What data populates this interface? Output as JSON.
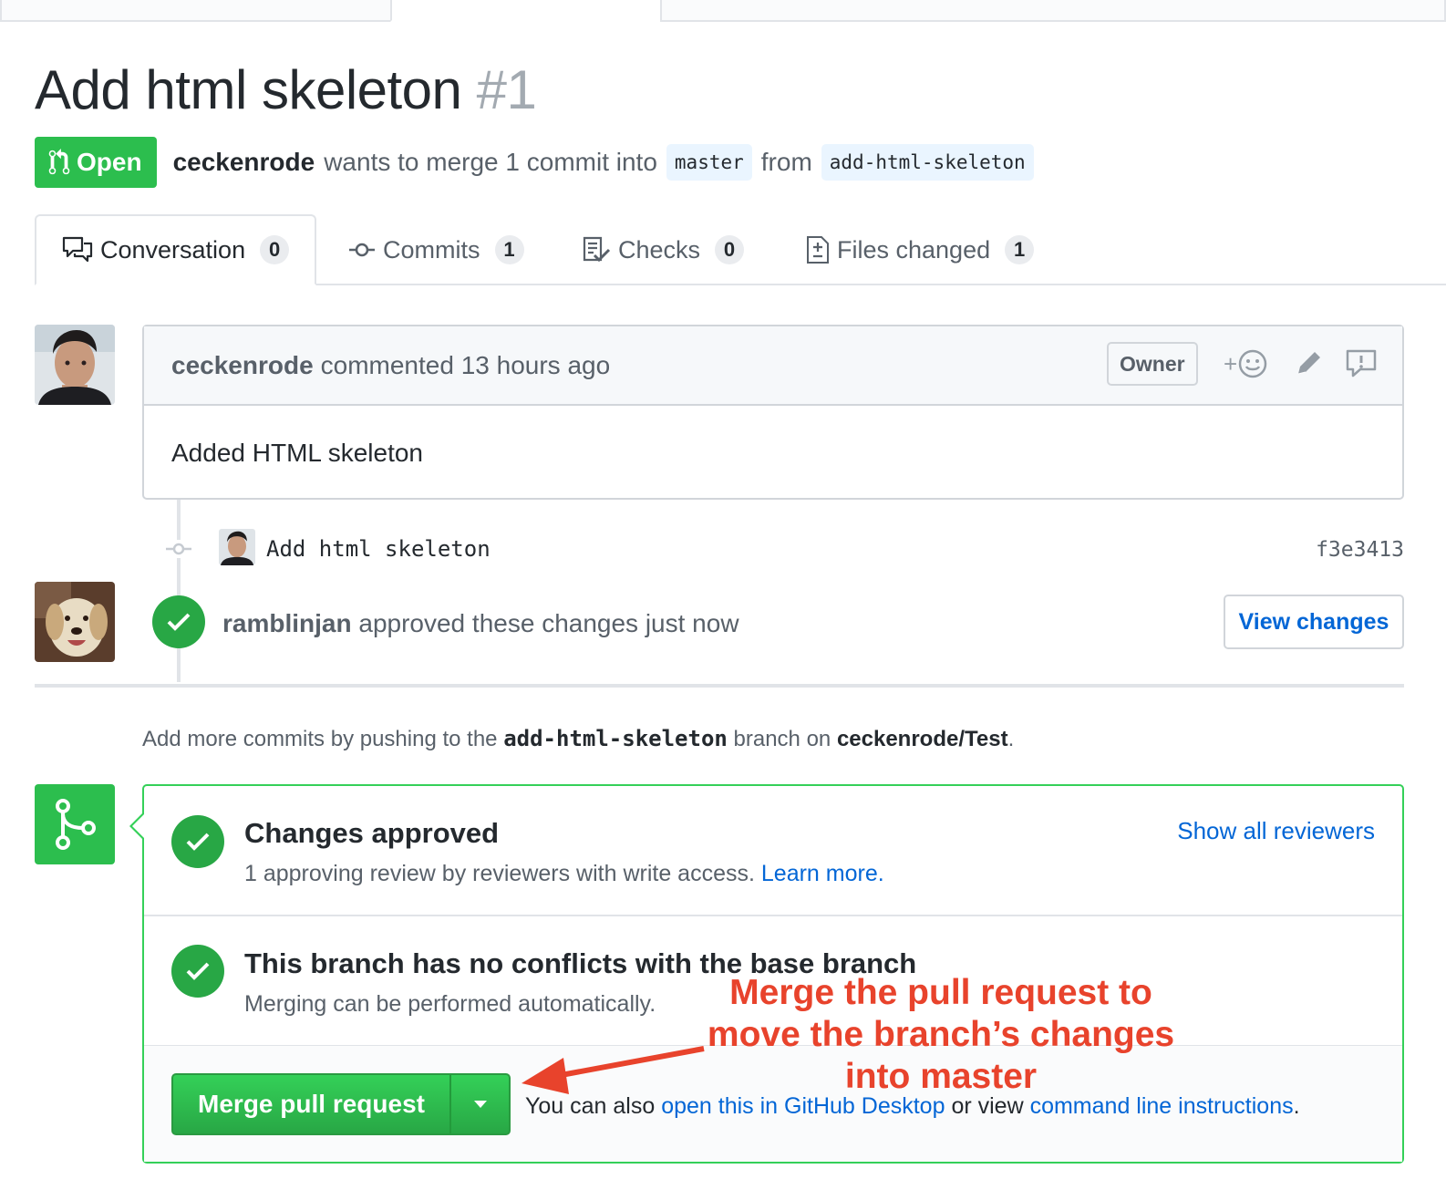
{
  "pr": {
    "title": "Add html skeleton",
    "number": "#1",
    "state": "Open",
    "author": "ceckenrode",
    "merge_text": "wants to merge 1 commit into",
    "base_branch": "master",
    "from_word": "from",
    "head_branch": "add-html-skeleton"
  },
  "tabs": [
    {
      "label": "Conversation",
      "count": "0",
      "icon": "comment-discussion-icon"
    },
    {
      "label": "Commits",
      "count": "1",
      "icon": "commit-icon"
    },
    {
      "label": "Checks",
      "count": "0",
      "icon": "checklist-icon"
    },
    {
      "label": "Files changed",
      "count": "1",
      "icon": "diff-icon"
    }
  ],
  "comment": {
    "author": "ceckenrode",
    "action": "commented 13 hours ago",
    "badge": "Owner",
    "reaction_plus": "+",
    "body": "Added HTML skeleton"
  },
  "commit": {
    "message": "Add html skeleton",
    "sha": "f3e3413"
  },
  "review": {
    "reviewer": "ramblinjan",
    "text": "approved these changes just now",
    "button": "View changes"
  },
  "hint": {
    "prefix": "Add more commits by pushing to the",
    "branch": "add-html-skeleton",
    "middle": "branch on",
    "repo": "ceckenrode/Test",
    "suffix": "."
  },
  "merge": {
    "approved_title": "Changes approved",
    "approved_sub": "1 approving review by reviewers with write access.",
    "learn_more": "Learn more.",
    "show_reviewers": "Show all reviewers",
    "conflict_title": "This branch has no conflicts with the base branch",
    "conflict_sub": "Merging can be performed automatically.",
    "button": "Merge pull request",
    "also_prefix": "You can also",
    "desktop_link": "open this in GitHub Desktop",
    "also_middle": "or view",
    "cli_link": "command line instructions",
    "also_suffix": "."
  },
  "annotation": {
    "line1": "Merge the pull request to",
    "line2": "move the branch’s changes",
    "line3": "into master"
  },
  "colors": {
    "green": "#2cbe4e",
    "link": "#0366d6",
    "annotation": "#e8432c"
  }
}
